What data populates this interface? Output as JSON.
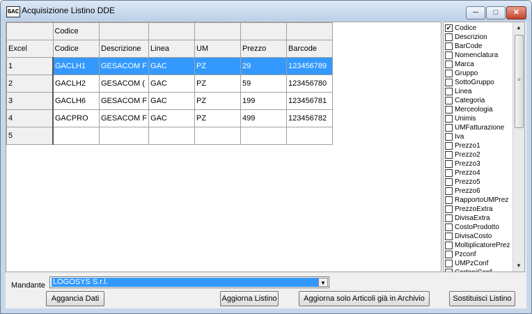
{
  "window": {
    "title": "Acquisizione Listino DDE",
    "icon": "app-logo-icon"
  },
  "grid": {
    "rows": [
      [
        "",
        "Codice",
        "",
        "",
        "",
        "",
        ""
      ],
      [
        "Excel",
        "Codice",
        "Descrizione",
        "Linea",
        "UM",
        "Prezzo",
        "Barcode"
      ],
      [
        "1",
        "GACLH1",
        "GESACOM F",
        "GAC",
        "PZ",
        "29",
        "123456789"
      ],
      [
        "2",
        "GACLH2",
        "GESACOM (",
        "GAC",
        "PZ",
        "59",
        "123456780"
      ],
      [
        "3",
        "GACLH6",
        "GESACOM F",
        "GAC",
        "PZ",
        "199",
        "123456781"
      ],
      [
        "4",
        "GACPRO",
        "GESACOM F",
        "GAC",
        "PZ",
        "499",
        "123456782"
      ],
      [
        "5",
        "",
        "",
        "",
        "",
        "",
        ""
      ]
    ],
    "selected_row": 2
  },
  "fields": [
    {
      "label": "Codice",
      "checked": true
    },
    {
      "label": "Descrizion",
      "checked": false
    },
    {
      "label": "BarCode",
      "checked": false
    },
    {
      "label": "Nomenclatura",
      "checked": false
    },
    {
      "label": "Marca",
      "checked": false
    },
    {
      "label": "Gruppo",
      "checked": false
    },
    {
      "label": "SottoGruppo",
      "checked": false
    },
    {
      "label": "Linea",
      "checked": false
    },
    {
      "label": "Categoria",
      "checked": false
    },
    {
      "label": "Merceologia",
      "checked": false
    },
    {
      "label": "Unimis",
      "checked": false
    },
    {
      "label": "UMFatturazione",
      "checked": false
    },
    {
      "label": "Iva",
      "checked": false
    },
    {
      "label": "Prezzo1",
      "checked": false
    },
    {
      "label": "Prezzo2",
      "checked": false
    },
    {
      "label": "Prezzo3",
      "checked": false
    },
    {
      "label": "Prezzo4",
      "checked": false
    },
    {
      "label": "Prezzo5",
      "checked": false
    },
    {
      "label": "Prezzo6",
      "checked": false
    },
    {
      "label": "RapportoUMPrez",
      "checked": false
    },
    {
      "label": "PrezzoExtra",
      "checked": false
    },
    {
      "label": "DivisaExtra",
      "checked": false
    },
    {
      "label": "CostoProdotto",
      "checked": false
    },
    {
      "label": "DivisaCosto",
      "checked": false
    },
    {
      "label": "MoltiplicatorePrez",
      "checked": false
    },
    {
      "label": "Pzconf",
      "checked": false
    },
    {
      "label": "UMPzConf",
      "checked": false
    },
    {
      "label": "CartoniConf",
      "checked": false
    }
  ],
  "mandante": {
    "label": "Mandante",
    "value": "LOGOSYS S.r.l."
  },
  "buttons": {
    "aggancia": "Aggancia Dati",
    "aggiorna": "Aggiorna Listino",
    "aggiorna_solo": "Aggiorna solo Articoli già in Archivio",
    "sostituisci": "Sostituisci Listino"
  }
}
